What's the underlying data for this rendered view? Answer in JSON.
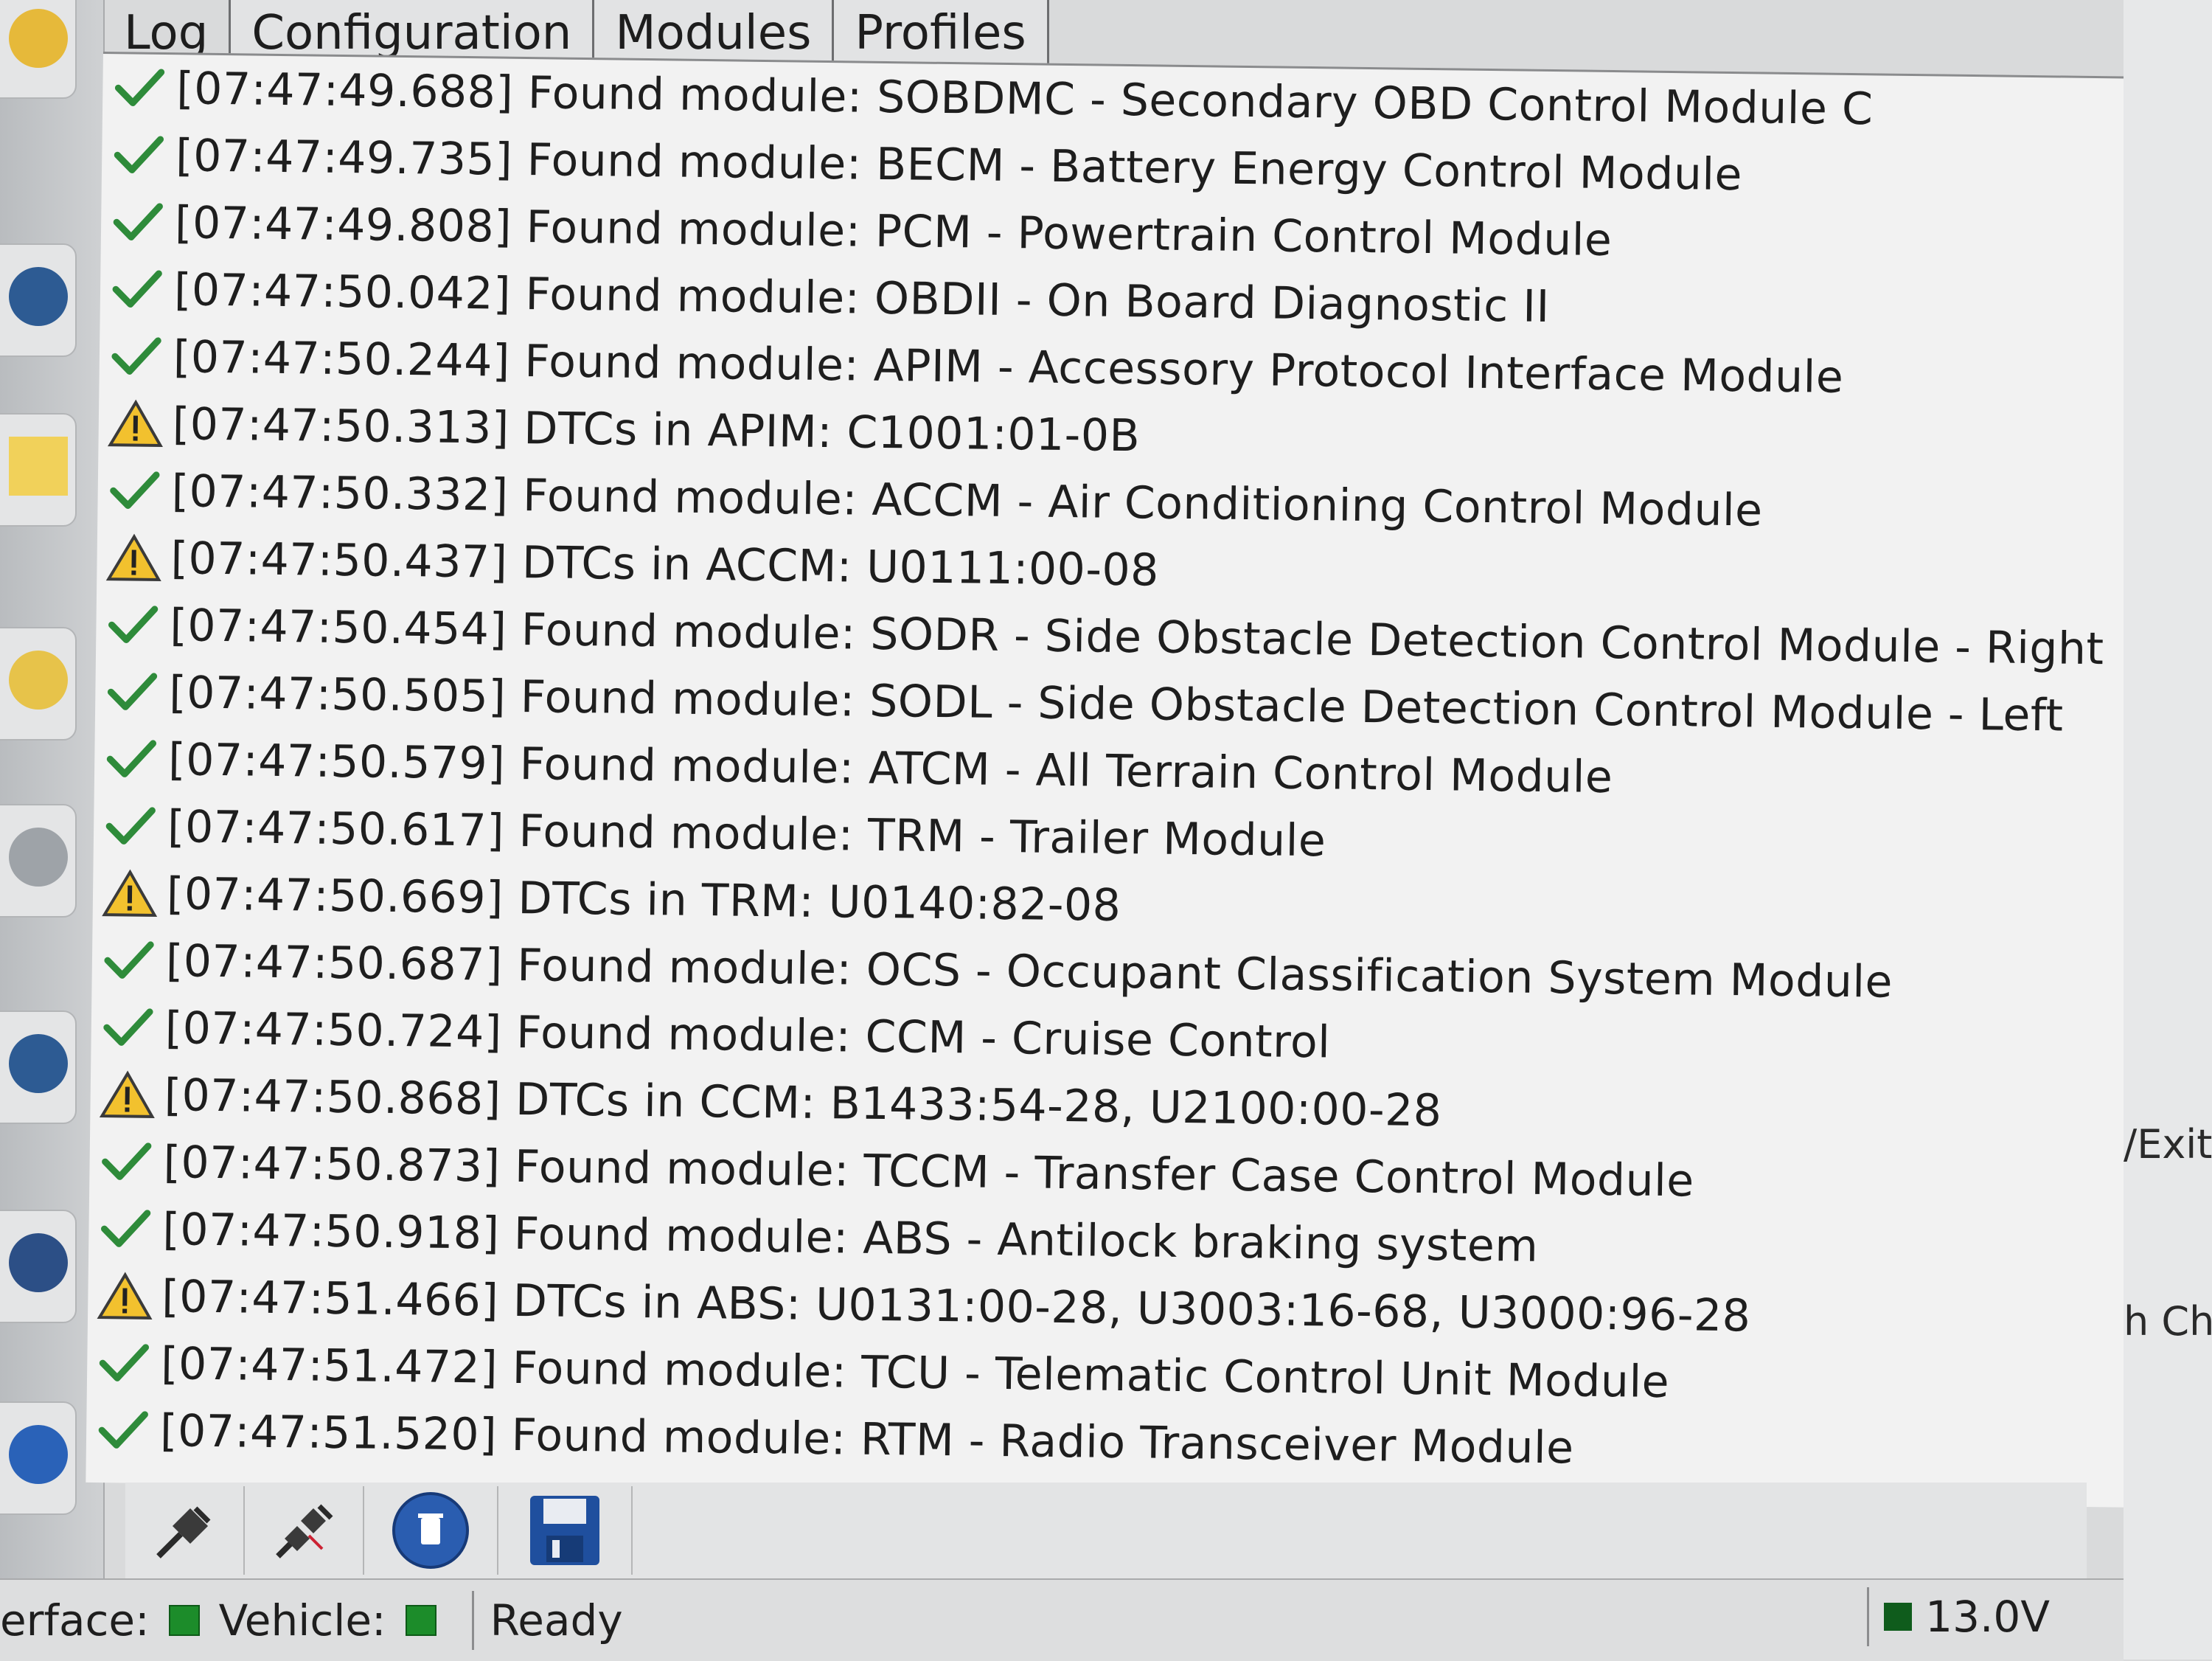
{
  "tabs": [
    {
      "label": "Log"
    },
    {
      "label": "Configuration"
    },
    {
      "label": "Modules"
    },
    {
      "label": "Profiles"
    }
  ],
  "log": [
    {
      "status": "ok",
      "text": "[07:47:49.688] Found module:  SOBDMC - Secondary OBD Control Module C"
    },
    {
      "status": "ok",
      "text": "[07:47:49.735] Found module:  BECM - Battery Energy Control Module"
    },
    {
      "status": "ok",
      "text": "[07:47:49.808] Found module:  PCM - Powertrain Control Module"
    },
    {
      "status": "ok",
      "text": "[07:47:50.042] Found module:  OBDII - On Board Diagnostic II"
    },
    {
      "status": "ok",
      "text": "[07:47:50.244] Found module:  APIM - Accessory Protocol Interface Module"
    },
    {
      "status": "warn",
      "text": "[07:47:50.313] DTCs in APIM: C1001:01-0B"
    },
    {
      "status": "ok",
      "text": "[07:47:50.332] Found module:  ACCM - Air Conditioning Control Module"
    },
    {
      "status": "warn",
      "text": "[07:47:50.437] DTCs in ACCM: U0111:00-08"
    },
    {
      "status": "ok",
      "text": "[07:47:50.454] Found module:  SODR - Side Obstacle Detection Control Module - Right"
    },
    {
      "status": "ok",
      "text": "[07:47:50.505] Found module:  SODL - Side Obstacle Detection Control Module - Left"
    },
    {
      "status": "ok",
      "text": "[07:47:50.579] Found module:  ATCM - All Terrain Control Module"
    },
    {
      "status": "ok",
      "text": "[07:47:50.617] Found module:  TRM - Trailer Module"
    },
    {
      "status": "warn",
      "text": "[07:47:50.669] DTCs in TRM: U0140:82-08"
    },
    {
      "status": "ok",
      "text": "[07:47:50.687] Found module:  OCS - Occupant Classification System Module"
    },
    {
      "status": "ok",
      "text": "[07:47:50.724] Found module:  CCM - Cruise Control"
    },
    {
      "status": "warn",
      "text": "[07:47:50.868] DTCs in CCM: B1433:54-28, U2100:00-28"
    },
    {
      "status": "ok",
      "text": "[07:47:50.873] Found module:  TCCM - Transfer Case Control Module"
    },
    {
      "status": "ok",
      "text": "[07:47:50.918] Found module:  ABS - Antilock braking system"
    },
    {
      "status": "warn",
      "text": "[07:47:51.466] DTCs in ABS: U0131:00-28, U3003:16-68, U3000:96-28"
    },
    {
      "status": "ok",
      "text": "[07:47:51.472] Found module:  TCU - Telematic Control Unit Module"
    },
    {
      "status": "ok",
      "text": "[07:47:51.520] Found module:  RTM - Radio Transceiver Module"
    }
  ],
  "background_window": {
    "exit_label": "/Exit (",
    "chan_label": "h Chan"
  },
  "statusbar": {
    "interface_label": "erface:",
    "vehicle_label": "Vehicle:",
    "state": "Ready",
    "voltage": "13.0V"
  },
  "toolbar_icons": [
    "connect-icon",
    "disconnect-icon",
    "clear-dtc-icon",
    "save-icon"
  ],
  "colors": {
    "ok_check": "#2e8b3a",
    "warn_fill": "#f2c12e",
    "led_green": "#1c8c2a",
    "clear_button": "#2a5db0",
    "save_button": "#1f4f9e"
  }
}
